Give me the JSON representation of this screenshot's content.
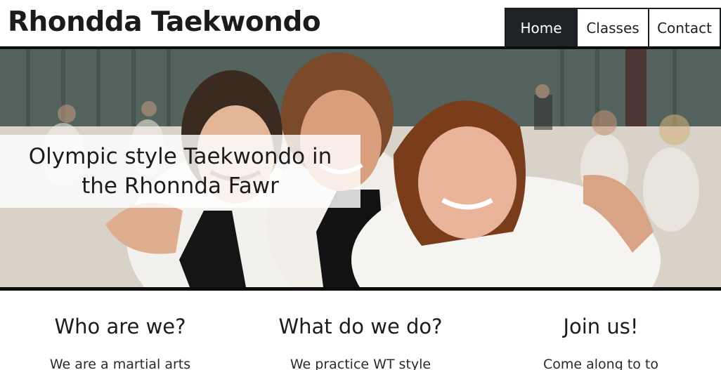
{
  "site": {
    "title": "Rhondda Taekwondo"
  },
  "nav": {
    "items": [
      {
        "label": "Home",
        "active": true
      },
      {
        "label": "Classes",
        "active": false
      },
      {
        "label": "Contact",
        "active": false
      }
    ]
  },
  "hero": {
    "caption": "Olympic style Taekwondo in the Rhonnda Fawr",
    "image": "photo of three smiling taekwondo students in white doboks in a training hall"
  },
  "sections": [
    {
      "heading": "Who are we?",
      "text": "We are a martial arts"
    },
    {
      "heading": "What do we do?",
      "text": "We practice WT style"
    },
    {
      "heading": "Join us!",
      "text": "Come along to to"
    }
  ],
  "colors": {
    "nav_active_bg": "#1f2328",
    "border": "#1b1e22",
    "caption_bg": "#ffffff"
  }
}
